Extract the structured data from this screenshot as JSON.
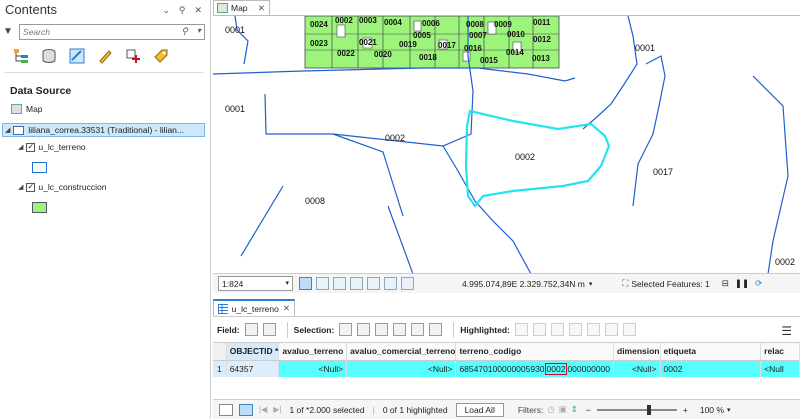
{
  "contents": {
    "title": "Contents",
    "pane_controls": [
      "⌄",
      "⚲",
      "✕"
    ],
    "search_placeholder": "Search",
    "data_source_heading": "Data Source",
    "tree": {
      "map_label": "Map",
      "db_label": "liliana_correa.33531 (Traditional) - lilian...",
      "layers": [
        {
          "name": "u_lc_terreno",
          "checked": "✓",
          "symbol_color": "#ffffff",
          "outline_color": "#1f6fd1"
        },
        {
          "name": "u_lc_construccion",
          "checked": "✓",
          "symbol_color": "#9cf47a",
          "outline_color": "#556655"
        }
      ]
    }
  },
  "map": {
    "tab_label": "Map",
    "parcel_labels": [
      "0001",
      "0001",
      "0001",
      "0002",
      "0002",
      "0017",
      "0008",
      "0002"
    ],
    "building_labels": [
      "0024",
      "0002",
      "0003",
      "0004",
      "0006",
      "0008",
      "0009",
      "0011",
      "0005",
      "0007",
      "0010",
      "0012",
      "0023",
      "0021",
      "0019",
      "0017",
      "0016",
      "0014",
      "0013",
      "0022",
      "0020",
      "0018",
      "0015"
    ],
    "colors": {
      "parcel_line": "#1f5fd1",
      "selected_outline": "#22e4ee",
      "building_fill": "#9cf47a"
    }
  },
  "map_status": {
    "scale": "1:824",
    "coordinates": "4.995.074,89E 2.329.752,34N m",
    "selected_features": "Selected Features: 1"
  },
  "attribute_table": {
    "tab_label": "u_lc_terreno",
    "toolbar": {
      "field_label": "Field:",
      "selection_label": "Selection:",
      "highlighted_label": "Highlighted:"
    },
    "columns": [
      "OBJECTID *",
      "avaluo_terreno",
      "avaluo_comercial_terreno",
      "terreno_codigo",
      "dimension",
      "etiqueta",
      "relac"
    ],
    "rows": [
      {
        "row_number": "1",
        "objectid": "64357",
        "avaluo_terreno": "<Null>",
        "avaluo_comercial_terreno": "<Null>",
        "terreno_codigo_prefix": "685470100000005930",
        "terreno_codigo_highlight": "0002",
        "terreno_codigo_suffix": "000000000",
        "dimension": "<Null>",
        "etiqueta": "0002",
        "relac": "<Null"
      }
    ]
  },
  "footer": {
    "selected_text": "1 of *2.000 selected",
    "highlighted_text": "0 of 1 highlighted",
    "load_all": "Load All",
    "filters_label": "Filters:",
    "zoom": "100 %"
  }
}
